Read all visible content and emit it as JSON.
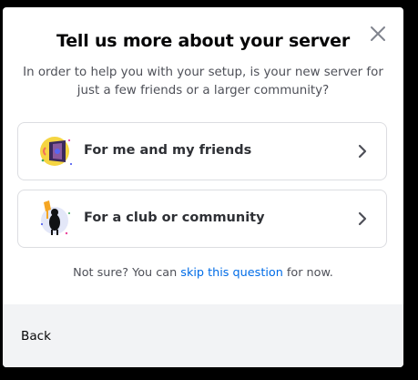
{
  "modal": {
    "title": "Tell us more about your server",
    "subtitle": "In order to help you with your setup, is your new server for just a few friends or a larger community?",
    "close_icon": "close-icon"
  },
  "options": [
    {
      "label": "For me and my friends",
      "icon": "friends-illustration-icon",
      "chevron_icon": "chevron-right-icon"
    },
    {
      "label": "For a club or community",
      "icon": "community-illustration-icon",
      "chevron_icon": "chevron-right-icon"
    }
  ],
  "hint": {
    "prefix": "Not sure? You can ",
    "link": "skip this question",
    "suffix": " for now."
  },
  "footer": {
    "back_label": "Back"
  },
  "colors": {
    "background": "#000000",
    "modal": "#ffffff",
    "footer": "#f2f3f5",
    "link": "#006ce7",
    "title": "#060607",
    "muted": "#4e5058",
    "border": "#dcdde1"
  }
}
